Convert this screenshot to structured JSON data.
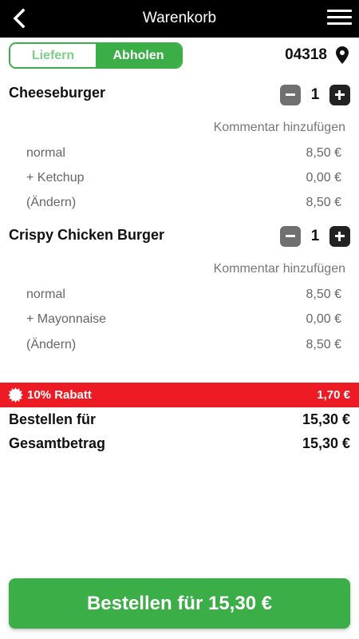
{
  "header": {
    "title": "Warenkorb"
  },
  "delivery_mode": {
    "options": [
      "Liefern",
      "Abholen"
    ],
    "selected": "Abholen"
  },
  "location": {
    "postcode": "04318"
  },
  "items": [
    {
      "name": "Cheeseburger",
      "quantity": "1",
      "comment_label": "Kommentar hinzufügen",
      "options": [
        {
          "label": "normal",
          "price": "8,50 €"
        },
        {
          "label": "+ Ketchup",
          "price": "0,00 €"
        },
        {
          "label": "(Ändern)",
          "price": "8,50 €"
        }
      ]
    },
    {
      "name": "Crispy Chicken Burger",
      "quantity": "1",
      "comment_label": "Kommentar hinzufügen",
      "options": [
        {
          "label": "normal",
          "price": "8,50 €"
        },
        {
          "label": "+ Mayonnaise",
          "price": "0,00 €"
        },
        {
          "label": "(Ändern)",
          "price": "8,50 €"
        }
      ]
    }
  ],
  "discount": {
    "label": "10% Rabatt",
    "value": "1,70 €"
  },
  "summary": {
    "order_for_label": "Bestellen für",
    "order_for_value": "15,30 €",
    "total_label": "Gesamtbetrag",
    "total_value": "15,30 €"
  },
  "order_button": {
    "label": "Bestellen für 15,30 €"
  },
  "colors": {
    "accent_green": "#3cae48",
    "discount_red": "#ed1c24",
    "header_black": "#000000"
  }
}
